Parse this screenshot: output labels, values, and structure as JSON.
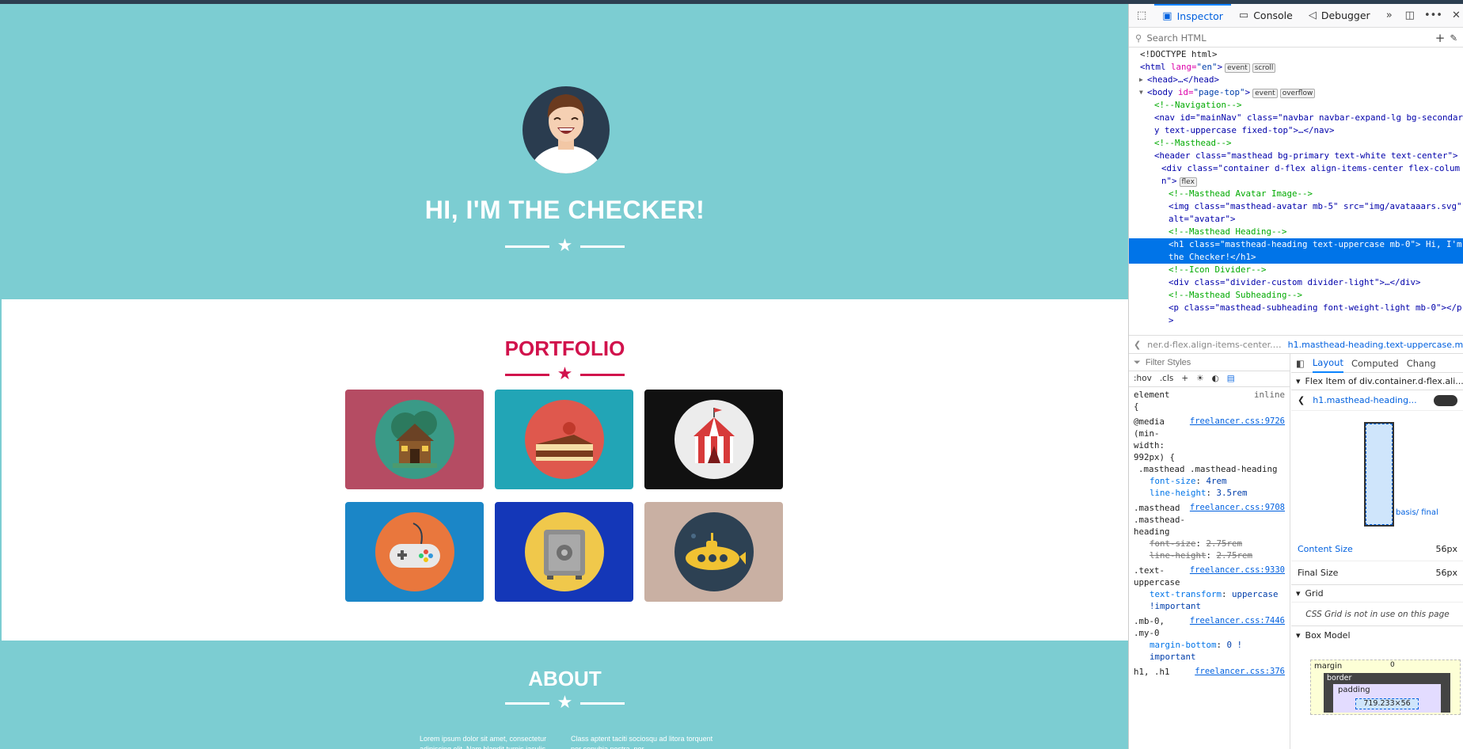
{
  "site": {
    "masthead_heading": "Hi, I'm the Checker!",
    "portfolio_heading": "Portfolio",
    "about_heading": "About",
    "about_left": "Lorem ipsum dolor sit amet, consectetur adipiscing elit. Nam blandit turpis iaculis",
    "about_right": "Class aptent taciti sociosqu ad litora torquent per conubia nostra, per",
    "tiles": [
      {
        "name": "cabin",
        "bg": "#b54c63",
        "circle": "#3a9a87"
      },
      {
        "name": "cake",
        "bg": "#22a5b6",
        "circle": "#df584d"
      },
      {
        "name": "circus",
        "bg": "#111111",
        "circle": "#ececec"
      },
      {
        "name": "game",
        "bg": "#1b86c7",
        "circle": "#e9773d"
      },
      {
        "name": "safe",
        "bg": "#1437b8",
        "circle": "#f0c84b"
      },
      {
        "name": "submarine",
        "bg": "#c9b0a3",
        "circle": "#2d4153"
      }
    ],
    "colors": {
      "primary": "#7ccdd2",
      "accent": "#d1124c"
    }
  },
  "devtools": {
    "tabs": [
      "Inspector",
      "Console",
      "Debugger"
    ],
    "search_placeholder": "Search HTML",
    "tree": [
      {
        "i": 0,
        "html": "<!DOCTYPE html>"
      },
      {
        "i": 0,
        "tag": "html",
        "attrs": [
          [
            "lang",
            "\"en\""
          ]
        ],
        "badges": [
          "event",
          "scroll"
        ]
      },
      {
        "i": 1,
        "tag": "head",
        "collapsed": true
      },
      {
        "i": 1,
        "tag": "body",
        "attrs": [
          [
            "id",
            "\"page-top\""
          ]
        ],
        "badges": [
          "event",
          "overflow"
        ],
        "open": true
      },
      {
        "i": 2,
        "comment": "<!--Navigation-->"
      },
      {
        "i": 2,
        "raw": "<nav id=\"mainNav\" class=\"navbar navbar-expand-lg bg-secondary text-uppercase fixed-top\">…</nav>"
      },
      {
        "i": 2,
        "comment": "<!--Masthead-->"
      },
      {
        "i": 2,
        "raw": "<header class=\"masthead bg-primary text-white text-center\">"
      },
      {
        "i": 3,
        "raw": "<div class=\"container d-flex align-items-center flex-column\">",
        "badges": [
          "flex"
        ]
      },
      {
        "i": 4,
        "comment": "<!--Masthead Avatar Image-->"
      },
      {
        "i": 4,
        "raw": "<img class=\"masthead-avatar mb-5\" src=\"img/avataaars.svg\" alt=\"avatar\">"
      },
      {
        "i": 4,
        "comment": "<!--Masthead Heading-->"
      },
      {
        "i": 4,
        "raw": "<h1 class=\"masthead-heading text-uppercase mb-0\"> Hi, I'm the Checker!</h1>",
        "sel": true
      },
      {
        "i": 4,
        "comment": "<!--Icon Divider-->"
      },
      {
        "i": 4,
        "raw": "<div class=\"divider-custom divider-light\">…</div>"
      },
      {
        "i": 4,
        "comment": "<!--Masthead Subheading-->"
      },
      {
        "i": 4,
        "raw": "<p class=\"masthead-subheading font-weight-light mb-0\"></p>"
      }
    ],
    "breadcrumb": [
      "ner.d-flex.align-items-center.…",
      "h1.masthead-heading.text-uppercase.mb-0"
    ],
    "filter_placeholder": "Filter Styles",
    "pseudo": [
      ":hov",
      ".cls"
    ],
    "layout_tabs": [
      "Layout",
      "Computed",
      "Chang"
    ],
    "flex_item_title": "Flex Item of div.container.d-flex.ali...",
    "flex_item_selector": "h1.masthead-heading...",
    "content_size_label": "Content Size",
    "content_size": "56px",
    "final_size_label": "Final Size",
    "final_size": "56px",
    "basis_label": "basis/ final",
    "grid_label": "Grid",
    "grid_note": "CSS Grid is not in use on this page",
    "boxmodel_label": "Box Model",
    "bm_margin": "margin",
    "bm_border": "border",
    "bm_padding": "padding",
    "bm_size": "719.233×56",
    "bm_zero": "0",
    "rules": [
      {
        "sel": "element",
        "brace": "{",
        "src": "",
        "extra": "inline",
        "props": []
      },
      {
        "sel": "@media (min-width: 992px) {",
        "src": "freelancer.css:9726",
        "sub": ".masthead .masthead-heading",
        "props": [
          [
            "font-size",
            "4rem",
            false
          ],
          [
            "line-height",
            "3.5rem",
            false
          ]
        ]
      },
      {
        "sel": ".masthead .masthead-heading",
        "src": "freelancer.css:9708",
        "props": [
          [
            "font-size",
            "2.75rem",
            true
          ],
          [
            "line-height",
            "2.75rem",
            true
          ]
        ]
      },
      {
        "sel": ".text-uppercase",
        "src": "freelancer.css:9330",
        "props": [
          [
            "text-transform",
            "uppercase !important",
            false
          ]
        ]
      },
      {
        "sel": ".mb-0, .my-0",
        "src": "freelancer.css:7446",
        "props": [
          [
            "margin-bottom",
            "0 ! important",
            false
          ]
        ]
      },
      {
        "sel": "h1, .h1",
        "src": "freelancer.css:376",
        "props": []
      }
    ]
  }
}
